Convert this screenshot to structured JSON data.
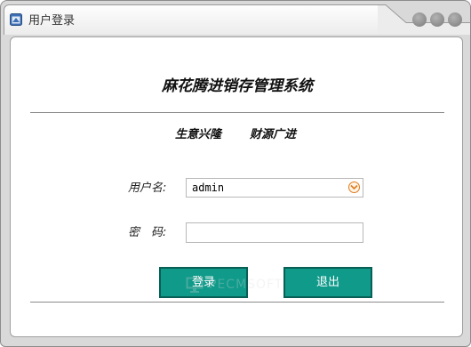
{
  "window": {
    "title": "用户登录"
  },
  "header": {
    "system_name": "麻花腾进销存管理系统",
    "slogan_left": "生意兴隆",
    "slogan_right": "财源广进"
  },
  "form": {
    "username_label": "用户名:",
    "username_value": "admin",
    "password_label": "密　码:",
    "password_value": ""
  },
  "buttons": {
    "login": "登录",
    "exit": "退出"
  },
  "watermark": {
    "text": "PECMSOFT"
  },
  "icons": {
    "app": "app-window-icon",
    "dropdown": "chevron-down-icon",
    "window_controls": [
      "minimize-icon",
      "maximize-icon",
      "close-icon"
    ]
  },
  "colors": {
    "button_fill": "#0f9a8a",
    "button_border": "#085f55",
    "dropdown_accent": "#e07b1b"
  }
}
